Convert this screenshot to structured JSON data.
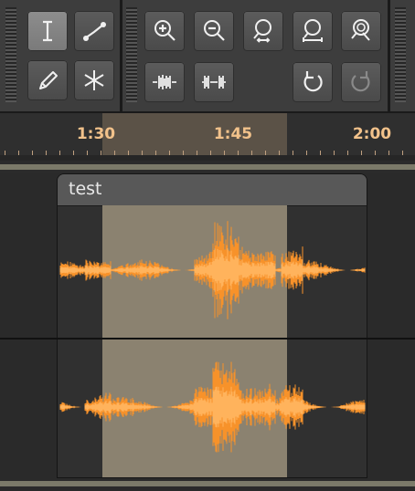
{
  "toolbar": {
    "tools": [
      {
        "name": "selection-tool",
        "icon": "ibeam-icon",
        "active": true
      },
      {
        "name": "envelope-tool",
        "icon": "envelope-icon",
        "active": false
      },
      {
        "name": "draw-tool",
        "icon": "pencil-icon",
        "active": false
      },
      {
        "name": "multi-tool",
        "icon": "asterisk-icon",
        "active": false
      }
    ],
    "edit_buttons": [
      {
        "name": "zoom-in-button",
        "icon": "zoom-in-icon"
      },
      {
        "name": "zoom-out-button",
        "icon": "zoom-out-icon"
      },
      {
        "name": "fit-selection-button",
        "icon": "zoom-fit-selection-icon"
      },
      {
        "name": "fit-project-button",
        "icon": "zoom-fit-project-icon"
      },
      {
        "name": "zoom-toggle-button",
        "icon": "zoom-toggle-icon"
      },
      {
        "name": "trim-audio-button",
        "icon": "trim-icon"
      },
      {
        "name": "silence-audio-button",
        "icon": "silence-icon"
      },
      {
        "name": "undo-button",
        "icon": "undo-icon"
      },
      {
        "name": "redo-button",
        "icon": "redo-icon",
        "disabled": true
      }
    ]
  },
  "ruler": {
    "labels": [
      "1:30",
      "1:45",
      "2:00"
    ]
  },
  "track": {
    "clip_name": "test",
    "waveform_color": "#f7922a",
    "selection_color": "#8b8270"
  }
}
